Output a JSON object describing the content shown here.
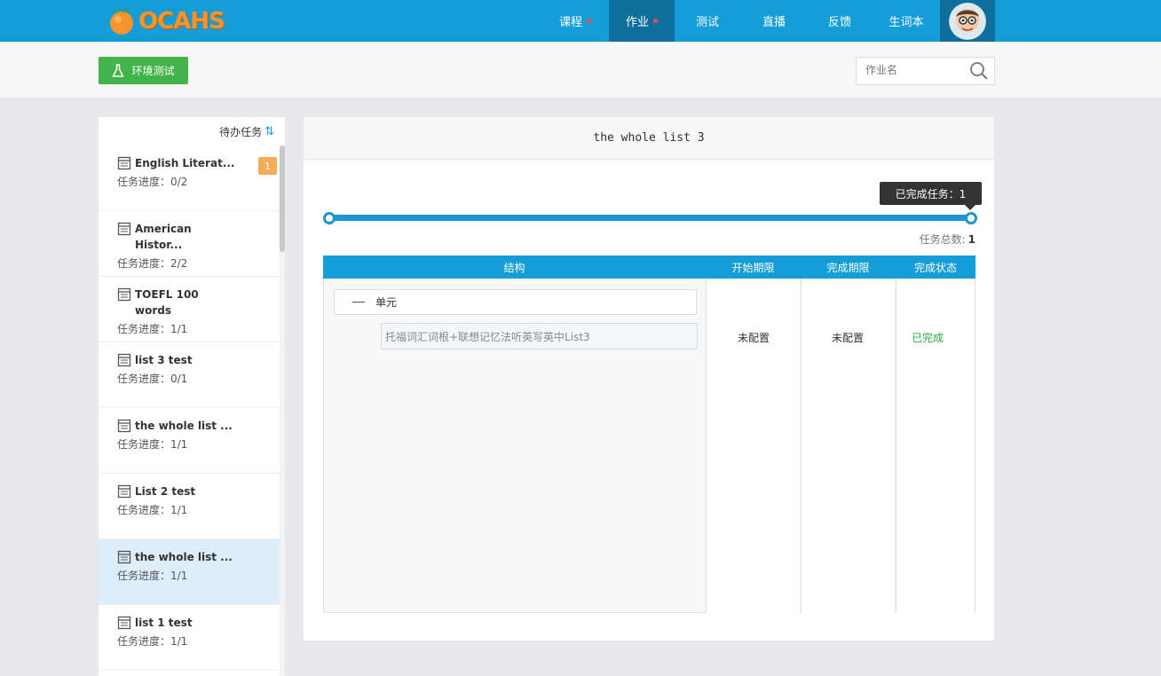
{
  "nav": {
    "logo_text": "OCAHS",
    "items": [
      {
        "label": "课程",
        "dot": true
      },
      {
        "label": "作业",
        "dot": true
      },
      {
        "label": "测试",
        "dot": false
      },
      {
        "label": "直播",
        "dot": false
      },
      {
        "label": "反馈",
        "dot": false
      },
      {
        "label": "生词本",
        "dot": false
      }
    ],
    "active": "作业"
  },
  "toolbar": {
    "env_test_label": "环境测试",
    "search_placeholder": "作业名"
  },
  "sidebar": {
    "header": "待办任务",
    "tasks": [
      {
        "title": "English Literat...",
        "progress": "任务进度：0/2",
        "badge": "1"
      },
      {
        "title": "American Histor...",
        "progress": "任务进度：2/2"
      },
      {
        "title": "TOEFL 100 words",
        "progress": "任务进度：1/1"
      },
      {
        "title": "list 3 test",
        "progress": "任务进度：0/1"
      },
      {
        "title": "the whole list ...",
        "progress": "任务进度：1/1"
      },
      {
        "title": "List 2 test",
        "progress": "任务进度：1/1"
      },
      {
        "title": "the whole list ...",
        "progress": "任务进度：1/1",
        "selected": true
      },
      {
        "title": "list 1 test",
        "progress": "任务进度：1/1"
      }
    ]
  },
  "main": {
    "title": "the whole list 3",
    "tooltip": "已完成任务：1",
    "progress_fraction": 1.0,
    "total_label": "任务总数:",
    "total_value": "1",
    "table": {
      "headers": [
        "结构",
        "开始期限",
        "完成期限",
        "完成状态"
      ],
      "unit_label": "单元",
      "lesson_label": "托福词汇词根+联想记忆法听英写英中List3",
      "start": "未配置",
      "end": "未配置",
      "status": "已完成"
    }
  },
  "colors": {
    "brand_blue": "#159dd8",
    "nav_active": "#0f6f9c",
    "green_button": "#43b449",
    "badge_orange": "#f6ad58",
    "done_green": "#2aa84a"
  }
}
